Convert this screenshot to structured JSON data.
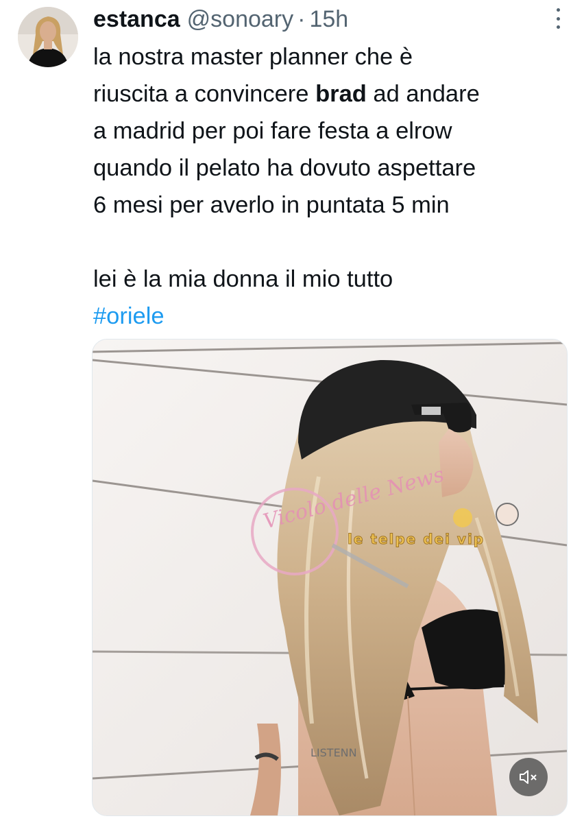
{
  "tweet": {
    "author": {
      "display_name": "estanca",
      "handle": "@sonoary",
      "separator": "·",
      "timestamp": "15h"
    },
    "text": {
      "line1": "la nostra master planner che è",
      "line2_before": "riuscita a convincere ",
      "line2_bold": "brad",
      "line2_after": " ad andare",
      "line3": "a madrid  per poi fare festa a elrow",
      "line4": "quando il pelato ha dovuto aspettare",
      "line5": "6 mesi per averlo in puntata 5 min",
      "line6": "lei è la mia donna il mio tutto",
      "hashtag": "#oriele"
    },
    "media": {
      "watermark_script": "Vicolo delle News",
      "watermark_banner": "le telpe dei vip",
      "video_caption": "LISTENN",
      "mute_icon": "speaker-muted-icon"
    }
  },
  "colors": {
    "text": "#0f1419",
    "secondary": "#536471",
    "link": "#1d9bf0"
  }
}
